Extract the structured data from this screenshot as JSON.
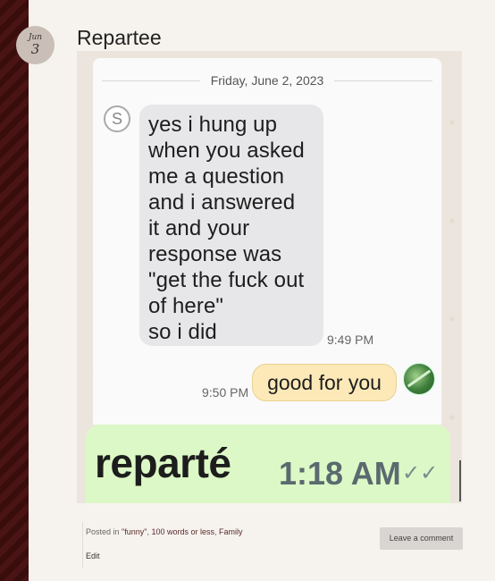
{
  "post": {
    "date_month": "Jun",
    "date_day": "3",
    "title": "Repartee"
  },
  "chat": {
    "day_divider": "Friday, June 2, 2023",
    "sender_initial": "S",
    "incoming_message": "yes i hung up\nwhen you asked\nme a question\nand i answered\nit and your\nresponse was\n\"get the fuck out\nof here\"\nso i did",
    "incoming_time": "9:49 PM",
    "outgoing_message": "good for you",
    "outgoing_time": "9:50 PM",
    "typed_text": "reparté",
    "typed_time": "1:18 AM",
    "read_ticks": "✓✓"
  },
  "footer": {
    "posted_in_prefix": "Posted in ",
    "categories": [
      "\"funny\"",
      "100 words or less",
      "Family"
    ],
    "edit_label": "Edit",
    "comment_button": "Leave a comment"
  },
  "colors": {
    "stripe": "#4a1414",
    "incoming_bubble": "#e7e7e9",
    "outgoing_bubble": "#fde9b8",
    "green_bar": "#dcf8c6"
  }
}
